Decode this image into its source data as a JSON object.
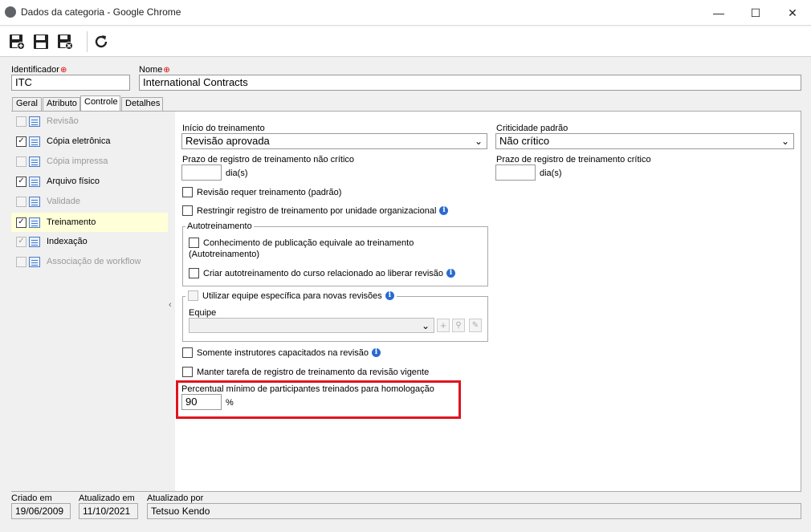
{
  "window": {
    "title": "Dados da categoria - Google Chrome",
    "minimize": "—",
    "maximize": "☐",
    "close": "✕"
  },
  "toolbar": {
    "save_new_icon": "save-new-icon",
    "save_icon": "save-icon",
    "save_close_icon": "save-close-icon",
    "refresh_icon": "refresh-icon"
  },
  "header": {
    "id_label": "Identificador",
    "id_value": "ITC",
    "name_label": "Nome",
    "name_value": "International Contracts"
  },
  "tabs": [
    "Geral",
    "Atributo",
    "Controle",
    "Detalhes"
  ],
  "sidebar": {
    "items": [
      {
        "label": "Revisão",
        "checked": false,
        "disabled": true
      },
      {
        "label": "Cópia eletrônica",
        "checked": true,
        "disabled": false
      },
      {
        "label": "Cópia impressa",
        "checked": false,
        "disabled": true
      },
      {
        "label": "Arquivo físico",
        "checked": true,
        "disabled": false
      },
      {
        "label": "Validade",
        "checked": false,
        "disabled": true
      },
      {
        "label": "Treinamento",
        "checked": true,
        "disabled": false,
        "selected": true
      },
      {
        "label": "Indexação",
        "checked": true,
        "disabled": true
      },
      {
        "label": "Associação de workflow",
        "checked": false,
        "disabled": true
      }
    ]
  },
  "form": {
    "inicio_label": "Início do treinamento",
    "inicio_value": "Revisão aprovada",
    "criticidade_label": "Criticidade padrão",
    "criticidade_value": "Não crítico",
    "prazo_nao_critico_label": "Prazo de registro de treinamento não crítico",
    "prazo_critico_label": "Prazo de registro de treinamento crítico",
    "dias_unit": "dia(s)",
    "revisao_requer": "Revisão requer treinamento (padrão)",
    "restringir": "Restringir registro de treinamento por unidade organizacional",
    "autotreinamento_title": "Autotreinamento",
    "conhecimento_line1": "Conhecimento de publicação equivale ao treinamento",
    "conhecimento_line2": "(Autotreinamento)",
    "criar_auto": "Criar autotreinamento do curso relacionado ao liberar revisão",
    "utilizar_equipe": "Utilizar equipe específica para novas revisões",
    "equipe_label": "Equipe",
    "somente_instrutores": "Somente instrutores capacitados na revisão",
    "manter_tarefa": "Manter tarefa de registro de treinamento da revisão vigente",
    "percentual_label": "Percentual mínimo de participantes treinados para homologação",
    "percentual_value": "90",
    "percent_unit": "%"
  },
  "footer": {
    "criado_label": "Criado em",
    "criado_value": "19/06/2009",
    "atualizado_label": "Atualizado em",
    "atualizado_value": "11/10/2021",
    "atualizado_por_label": "Atualizado por",
    "atualizado_por_value": "Tetsuo Kendo"
  },
  "colors": {
    "highlight": "#e0141e",
    "info": "#2a6ad0",
    "selected_row": "#ffffd8"
  }
}
